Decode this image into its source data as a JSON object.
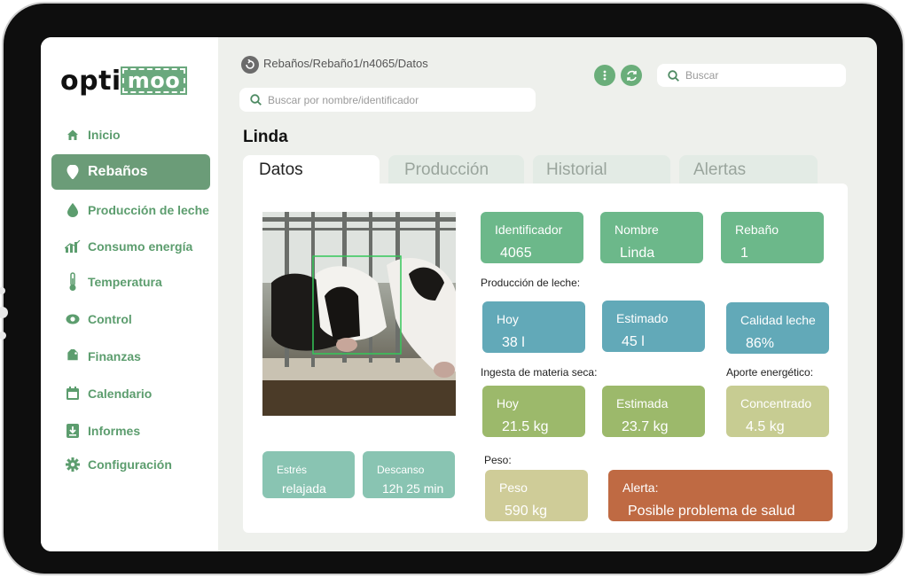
{
  "app": {
    "logo_main": "opti",
    "logo_mark": "moo"
  },
  "sidebar": {
    "items": [
      {
        "label": "Inicio",
        "icon": "home-icon"
      },
      {
        "label": "Rebaños",
        "icon": "location-pin-icon",
        "active": true
      },
      {
        "label": "Producción de leche",
        "icon": "drop-icon"
      },
      {
        "label": "Consumo energía",
        "icon": "bar-chart-icon"
      },
      {
        "label": "Temperatura",
        "icon": "thermometer-icon"
      },
      {
        "label": "Control",
        "icon": "eye-icon"
      },
      {
        "label": "Finanzas",
        "icon": "tag-icon"
      },
      {
        "label": "Calendario",
        "icon": "calendar-icon"
      },
      {
        "label": "Informes",
        "icon": "download-icon"
      },
      {
        "label": "Configuración",
        "icon": "gear-icon"
      }
    ]
  },
  "header": {
    "breadcrumb": "Rebaños/Rebaño1/n4065/Datos",
    "search_animal_placeholder": "Buscar por nombre/identificador",
    "search_placeholder": "Buscar"
  },
  "animal": {
    "name": "Linda",
    "tabs": [
      "Datos",
      "Producción",
      "Historial",
      "Alertas"
    ],
    "id_label": "Identificador",
    "id_value": "4065",
    "name_label": "Nombre",
    "name_value": "Linda",
    "herd_label": "Rebaño",
    "herd_value": "1",
    "milk_section": "Producción de leche:",
    "milk_today_label": "Hoy",
    "milk_today_value": "38 l",
    "milk_est_label": "Estimado",
    "milk_est_value": "45 l",
    "milk_quality_label": "Calidad leche",
    "milk_quality_value": "86%",
    "intake_section": "Ingesta de materia seca:",
    "intake_today_label": "Hoy",
    "intake_today_value": "21.5 kg",
    "intake_est_label": "Estimada",
    "intake_est_value": "23.7 kg",
    "energy_section": "Aporte energético:",
    "energy_label": "Concentrado",
    "energy_value": "4.5 kg",
    "stress_label": "Estrés",
    "stress_value": "relajada",
    "rest_label": "Descanso",
    "rest_value": "12h 25 min",
    "weight_section": "Peso:",
    "weight_label": "Peso",
    "weight_value": "590 kg",
    "alert_label": "Alerta:",
    "alert_value": "Posible problema de salud"
  },
  "colors": {
    "accent": "#6b9c78",
    "nav_text": "#5c9d6e",
    "alert": "#bf6a43"
  }
}
